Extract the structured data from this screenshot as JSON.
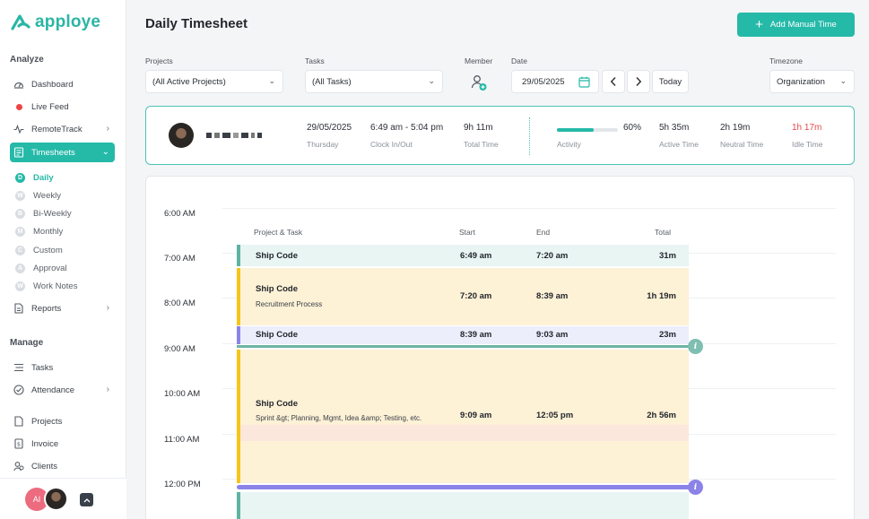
{
  "brand": {
    "name": "apploye"
  },
  "sidebar": {
    "analyze_label": "Analyze",
    "manage_label": "Manage",
    "items": {
      "dashboard": "Dashboard",
      "live_feed": "Live Feed",
      "remotetrack": "RemoteTrack",
      "timesheets": "Timesheets",
      "reports": "Reports",
      "tasks": "Tasks",
      "attendance": "Attendance",
      "projects": "Projects",
      "invoice": "Invoice",
      "clients": "Clients"
    },
    "timesheet_sub": {
      "daily": {
        "label": "Daily",
        "badge": "D"
      },
      "weekly": {
        "label": "Weekly",
        "badge": "W"
      },
      "biweekly": {
        "label": "Bi-Weekly",
        "badge": "B"
      },
      "monthly": {
        "label": "Monthly",
        "badge": "M"
      },
      "custom": {
        "label": "Custom",
        "badge": "C"
      },
      "approval": {
        "label": "Approval",
        "badge": "A"
      },
      "worknotes": {
        "label": "Work Notes",
        "badge": "W"
      }
    },
    "user_initials": "AI"
  },
  "header": {
    "title": "Daily Timesheet",
    "add_button": "Add Manual Time"
  },
  "filters": {
    "projects_label": "Projects",
    "projects_value": "(All Active Projects)",
    "tasks_label": "Tasks",
    "tasks_value": "(All Tasks)",
    "member_label": "Member",
    "date_label": "Date",
    "date_value": "29/05/2025",
    "today_button": "Today",
    "timezone_label": "Timezone",
    "timezone_value": "Organization"
  },
  "summary": {
    "date": "29/05/2025",
    "day": "Thursday",
    "clock": "6:49 am - 5:04 pm",
    "clock_label": "Clock In/Out",
    "total": "9h 11m",
    "total_label": "Total Time",
    "activity_percent": 60,
    "activity_text": "60%",
    "activity_label": "Activity",
    "active": "5h 35m",
    "active_label": "Active Time",
    "neutral": "2h 19m",
    "neutral_label": "Neutral Time",
    "idle": "1h 17m",
    "idle_label": "Idle Time"
  },
  "timeline": {
    "hours": [
      "6:00 AM",
      "7:00 AM",
      "8:00 AM",
      "9:00 AM",
      "10:00 AM",
      "11:00 AM",
      "12:00 PM"
    ],
    "headers": {
      "project_task": "Project & Task",
      "start": "Start",
      "end": "End",
      "total": "Total"
    },
    "entries": [
      {
        "title": "Ship Code",
        "subtitle": "",
        "start": "6:49 am",
        "end": "7:20 am",
        "total": "31m"
      },
      {
        "title": "Ship Code",
        "subtitle": "Recruitment Process",
        "start": "7:20 am",
        "end": "8:39 am",
        "total": "1h 19m"
      },
      {
        "title": "Ship Code",
        "subtitle": "",
        "start": "8:39 am",
        "end": "9:03 am",
        "total": "23m"
      },
      {
        "title": "Ship Code",
        "subtitle": "Sprint &gt; Planning, Mgmt, Idea &amp; Testing, etc.",
        "start": "9:09 am",
        "end": "12:05 pm",
        "total": "2h 56m"
      }
    ],
    "info_glyph": "i"
  },
  "colors": {
    "accent": "#25b9a8",
    "idle": "#e5484d",
    "entry_teal": "#5fb3a2",
    "entry_yellow": "#f5c518",
    "entry_purple": "#8b83e8"
  }
}
